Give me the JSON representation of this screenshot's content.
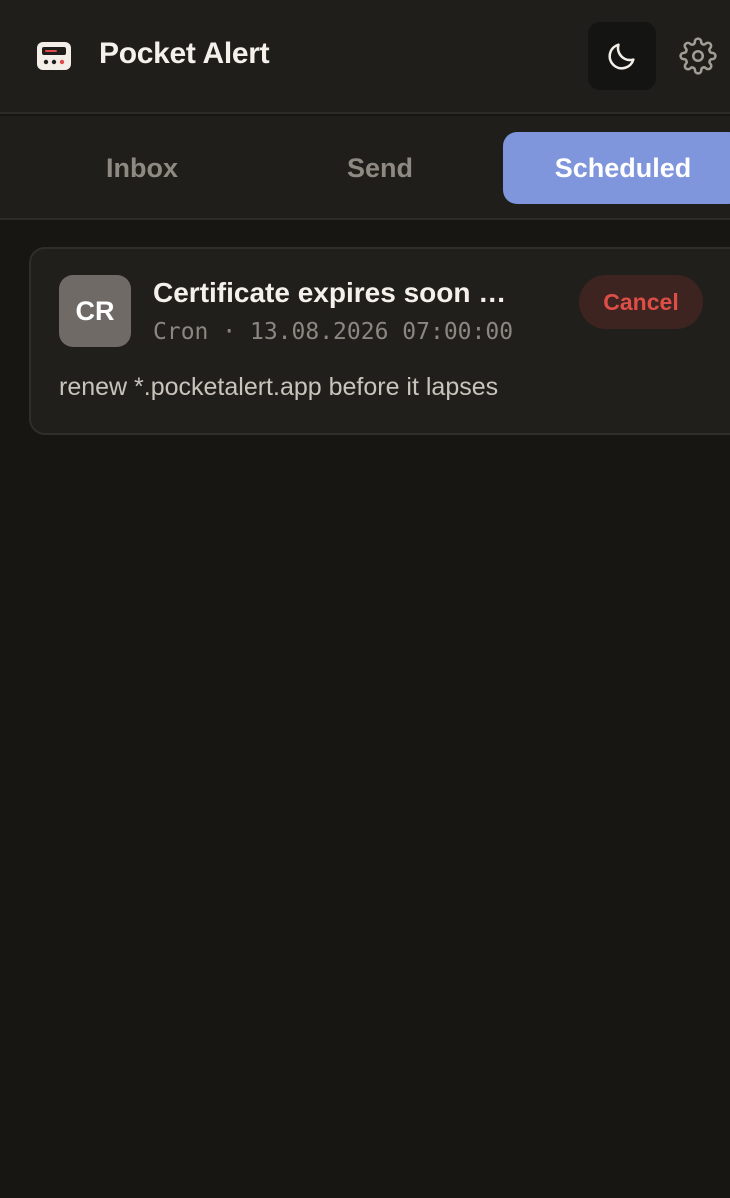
{
  "app": {
    "title": "Pocket Alert",
    "logo_icon": "pager-icon",
    "theme_icon": "moon-icon",
    "settings_icon": "gear-icon"
  },
  "tabs": [
    {
      "label": "Inbox",
      "active": false
    },
    {
      "label": "Send",
      "active": false
    },
    {
      "label": "Scheduled",
      "active": true
    }
  ],
  "scheduled": [
    {
      "avatar_initials": "CR",
      "title": "Certificate expires soon before renewal",
      "source": "Cron",
      "separator": "·",
      "datetime": "13.08.2026 07:00:00",
      "body": "renew *.pocketalert.app before it lapses",
      "cancel_label": "Cancel"
    }
  ],
  "colors": {
    "background": "#171612",
    "surface": "#1f1e1b",
    "accent": "#7f95dc",
    "danger": "#dd4e47",
    "danger_bg": "#3d2421",
    "avatar": "#6f6a65"
  }
}
